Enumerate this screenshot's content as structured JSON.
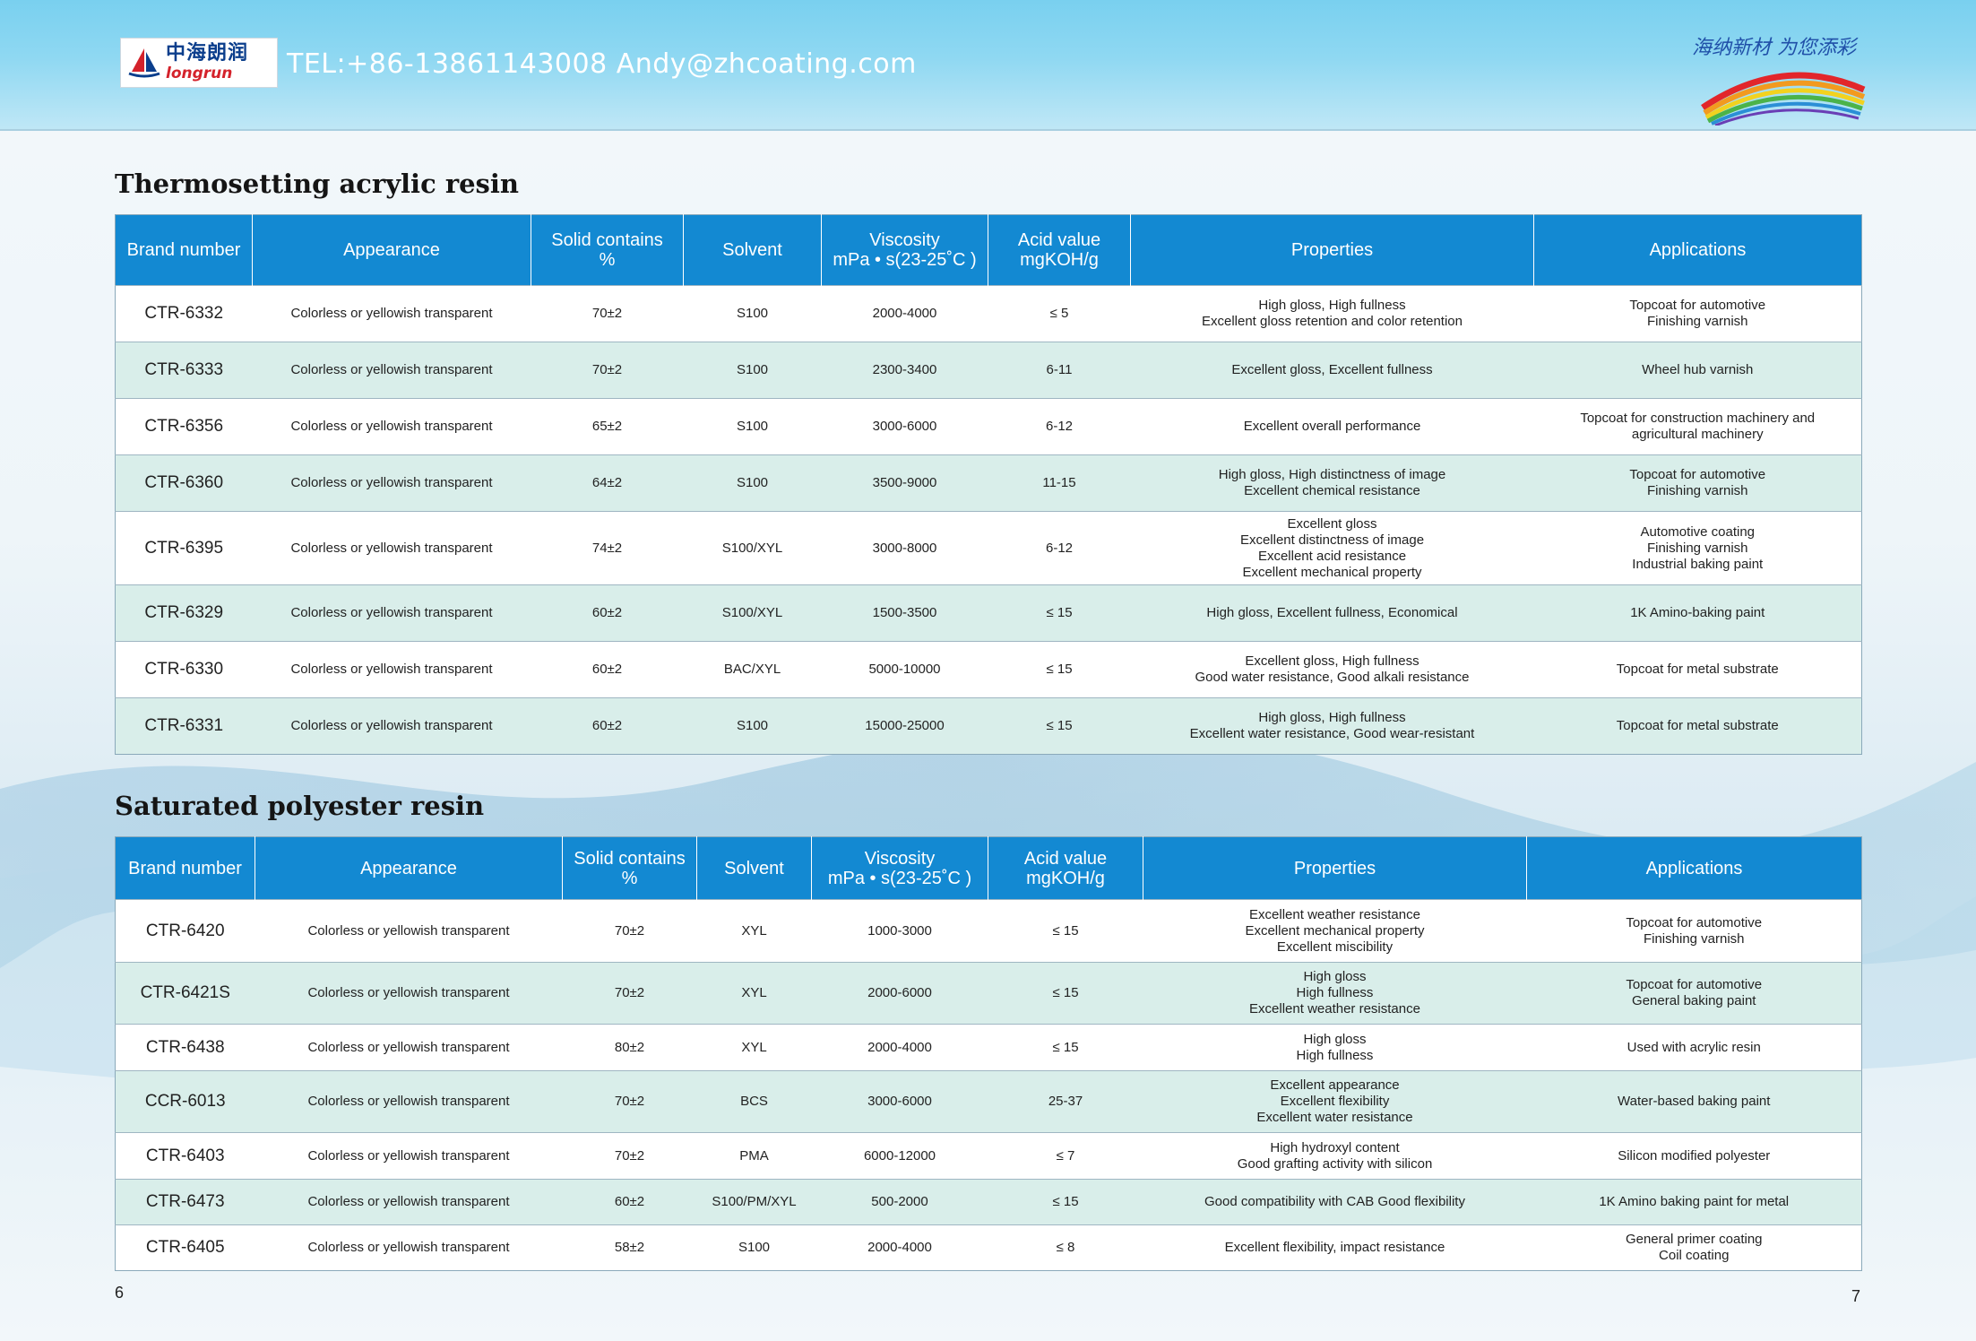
{
  "header": {
    "contact": "TEL:+86-13861143008  Andy@zhcoating.com",
    "logo_cn": "中海朗润",
    "logo_en": "longrun",
    "slogan": "海纳新材 为您添彩"
  },
  "columns": [
    "Brand number",
    "Appearance",
    "Solid contains %",
    "Solvent",
    "Viscosity mPa • s(23-25˚C )",
    "Acid value mgKOH/g",
    "Properties",
    "Applications"
  ],
  "sections": [
    {
      "title": "Thermosetting acrylic resin",
      "header": {
        "brand": "Brand number",
        "appearance": "Appearance",
        "solid_1": "Solid contains",
        "solid_2": "%",
        "solvent": "Solvent",
        "viscosity_1": "Viscosity",
        "viscosity_2": "mPa • s(23-25˚C )",
        "acid_1": "Acid value",
        "acid_2": "mgKOH/g",
        "properties": "Properties",
        "applications": "Applications"
      },
      "rows": [
        {
          "brand": "CTR-6332",
          "appearance": "Colorless or yellowish transparent",
          "solid": "70±2",
          "solvent": "S100",
          "viscosity": "2000-4000",
          "acid": "≤ 5",
          "properties": [
            "High gloss, High fullness",
            "Excellent gloss retention and color retention"
          ],
          "applications": [
            "Topcoat for automotive",
            "Finishing varnish"
          ]
        },
        {
          "brand": "CTR-6333",
          "appearance": "Colorless or yellowish transparent",
          "solid": "70±2",
          "solvent": "S100",
          "viscosity": "2300-3400",
          "acid": "6-11",
          "properties": [
            "Excellent gloss, Excellent fullness"
          ],
          "applications": [
            "Wheel hub varnish"
          ]
        },
        {
          "brand": "CTR-6356",
          "appearance": "Colorless or yellowish transparent",
          "solid": "65±2",
          "solvent": "S100",
          "viscosity": "3000-6000",
          "acid": "6-12",
          "properties": [
            "Excellent overall performance"
          ],
          "applications": [
            "Topcoat for construction machinery and",
            "agricultural machinery"
          ]
        },
        {
          "brand": "CTR-6360",
          "appearance": "Colorless or yellowish transparent",
          "solid": "64±2",
          "solvent": "S100",
          "viscosity": "3500-9000",
          "acid": "11-15",
          "properties": [
            "High gloss, High distinctness of image",
            "Excellent chemical resistance"
          ],
          "applications": [
            "Topcoat for automotive",
            "Finishing varnish"
          ]
        },
        {
          "brand": "CTR-6395",
          "appearance": "Colorless or yellowish transparent",
          "solid": "74±2",
          "solvent": "S100/XYL",
          "viscosity": "3000-8000",
          "acid": "6-12",
          "properties": [
            "Excellent gloss",
            "Excellent distinctness of image",
            "Excellent acid resistance",
            "Excellent mechanical property"
          ],
          "applications": [
            "Automotive coating",
            "Finishing varnish",
            "Industrial baking paint"
          ]
        },
        {
          "brand": "CTR-6329",
          "appearance": "Colorless or yellowish transparent",
          "solid": "60±2",
          "solvent": "S100/XYL",
          "viscosity": "1500-3500",
          "acid": "≤ 15",
          "properties": [
            "High gloss, Excellent fullness, Economical"
          ],
          "applications": [
            "1K Amino-baking paint"
          ]
        },
        {
          "brand": "CTR-6330",
          "appearance": "Colorless or yellowish transparent",
          "solid": "60±2",
          "solvent": "BAC/XYL",
          "viscosity": "5000-10000",
          "acid": "≤ 15",
          "properties": [
            "Excellent gloss, High fullness",
            "Good water resistance, Good alkali resistance"
          ],
          "applications": [
            "Topcoat for metal substrate"
          ]
        },
        {
          "brand": "CTR-6331",
          "appearance": "Colorless or yellowish transparent",
          "solid": "60±2",
          "solvent": "S100",
          "viscosity": "15000-25000",
          "acid": "≤ 15",
          "properties": [
            "High gloss, High fullness",
            "Excellent water resistance, Good wear-resistant"
          ],
          "applications": [
            "Topcoat for metal substrate"
          ]
        }
      ]
    },
    {
      "title": "Saturated polyester resin",
      "header": {
        "brand": "Brand number",
        "appearance": "Appearance",
        "solid_1": "Solid contains",
        "solid_2": "%",
        "solvent": "Solvent",
        "viscosity_1": "Viscosity",
        "viscosity_2": "mPa • s(23-25˚C )",
        "acid_1": "Acid value",
        "acid_2": "mgKOH/g",
        "properties": "Properties",
        "applications": "Applications"
      },
      "rows": [
        {
          "brand": "CTR-6420",
          "appearance": "Colorless or yellowish transparent",
          "solid": "70±2",
          "solvent": "XYL",
          "viscosity": "1000-3000",
          "acid": "≤ 15",
          "properties": [
            "Excellent weather resistance",
            "Excellent mechanical property",
            "Excellent miscibility"
          ],
          "applications": [
            "Topcoat for automotive",
            "Finishing varnish"
          ]
        },
        {
          "brand": "CTR-6421S",
          "appearance": "Colorless or yellowish transparent",
          "solid": "70±2",
          "solvent": "XYL",
          "viscosity": "2000-6000",
          "acid": "≤ 15",
          "properties": [
            "High gloss",
            "High fullness",
            "Excellent weather resistance"
          ],
          "applications": [
            "Topcoat for automotive",
            "General baking paint"
          ]
        },
        {
          "brand": "CTR-6438",
          "appearance": "Colorless or yellowish transparent",
          "solid": "80±2",
          "solvent": "XYL",
          "viscosity": "2000-4000",
          "acid": "≤ 15",
          "properties": [
            "High gloss",
            "High fullness"
          ],
          "applications": [
            "Used with acrylic resin"
          ]
        },
        {
          "brand": "CCR-6013",
          "appearance": "Colorless or yellowish transparent",
          "solid": "70±2",
          "solvent": "BCS",
          "viscosity": "3000-6000",
          "acid": "25-37",
          "properties": [
            "Excellent appearance",
            "Excellent flexibility",
            "Excellent water resistance"
          ],
          "applications": [
            "Water-based baking paint"
          ]
        },
        {
          "brand": "CTR-6403",
          "appearance": "Colorless or yellowish transparent",
          "solid": "70±2",
          "solvent": "PMA",
          "viscosity": "6000-12000",
          "acid": "≤ 7",
          "properties": [
            "High hydroxyl content",
            "Good grafting activity with silicon"
          ],
          "applications": [
            "Silicon modified polyester"
          ]
        },
        {
          "brand": "CTR-6473",
          "appearance": "Colorless or yellowish transparent",
          "solid": "60±2",
          "solvent": "S100/PM/XYL",
          "viscosity": "500-2000",
          "acid": "≤ 15",
          "properties": [
            "Good compatibility with CAB Good flexibility"
          ],
          "applications": [
            "1K Amino baking paint for metal"
          ]
        },
        {
          "brand": "CTR-6405",
          "appearance": "Colorless or yellowish transparent",
          "solid": "58±2",
          "solvent": "S100",
          "viscosity": "2000-4000",
          "acid": "≤ 8",
          "properties": [
            "Excellent flexibility, impact resistance"
          ],
          "applications": [
            "General primer coating",
            "Coil coating"
          ]
        }
      ]
    }
  ],
  "page_numbers": {
    "left": "6",
    "right": "7"
  }
}
